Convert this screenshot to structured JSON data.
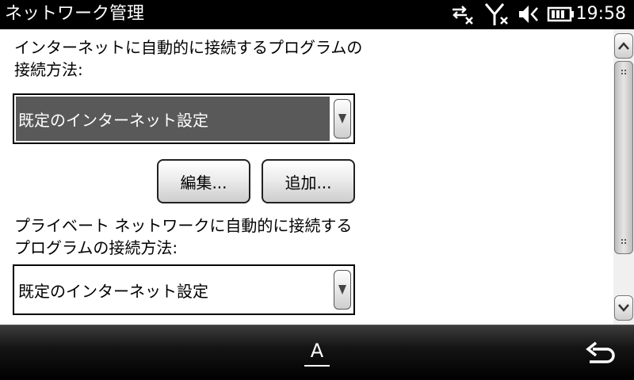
{
  "window": {
    "title": "ネットワーク管理"
  },
  "status_bar": {
    "time": "19:58",
    "icons": [
      "data-connection-off-icon",
      "signal-off-icon",
      "volume-muted-icon",
      "battery-icon"
    ]
  },
  "section_internet": {
    "label": "インターネットに自動的に接続するプログラムの接続方法:",
    "selected_value": "既定のインターネット設定"
  },
  "buttons": {
    "edit_label": "編集...",
    "add_label": "追加..."
  },
  "section_private": {
    "label": "プライベート ネットワークに自動的に接続するプログラムの接続方法:",
    "selected_value": "既定のインターネット設定"
  },
  "bottom_bar": {
    "ime_label": "A",
    "icons": [
      "input-method-icon",
      "back-arrow-icon"
    ]
  }
}
